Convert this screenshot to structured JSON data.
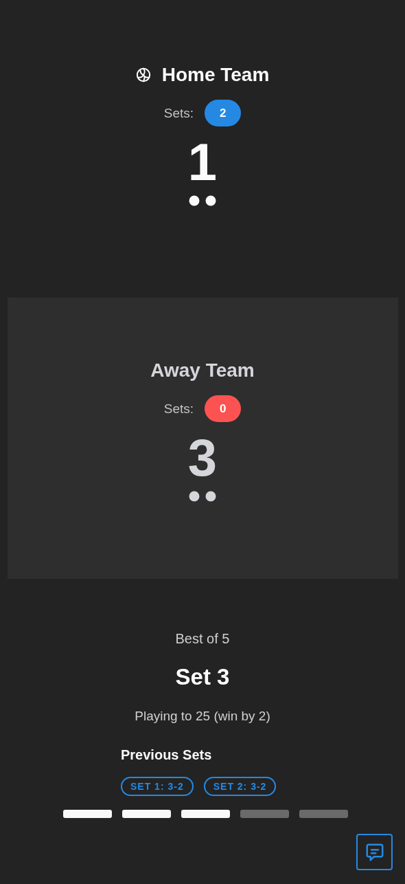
{
  "teams": [
    {
      "name": "Home Team",
      "serving": true,
      "highlighted": false,
      "sets_label": "Sets:",
      "sets": "2",
      "color": "#2589e3",
      "score": "1"
    },
    {
      "name": "Away Team",
      "serving": false,
      "highlighted": true,
      "sets_label": "Sets:",
      "sets": "0",
      "color": "#fc5352",
      "score": "3"
    }
  ],
  "match": {
    "format": "Best of 5",
    "set_title": "Set 3",
    "rule": "Playing to 25 (win by 2)"
  },
  "previous_sets": {
    "title": "Previous Sets",
    "chips": [
      "SET 1: 3-2",
      "SET 2: 3-2"
    ]
  },
  "set_progress": [
    {
      "done": true
    },
    {
      "done": true
    },
    {
      "done": true
    },
    {
      "done": false
    },
    {
      "done": false
    }
  ]
}
